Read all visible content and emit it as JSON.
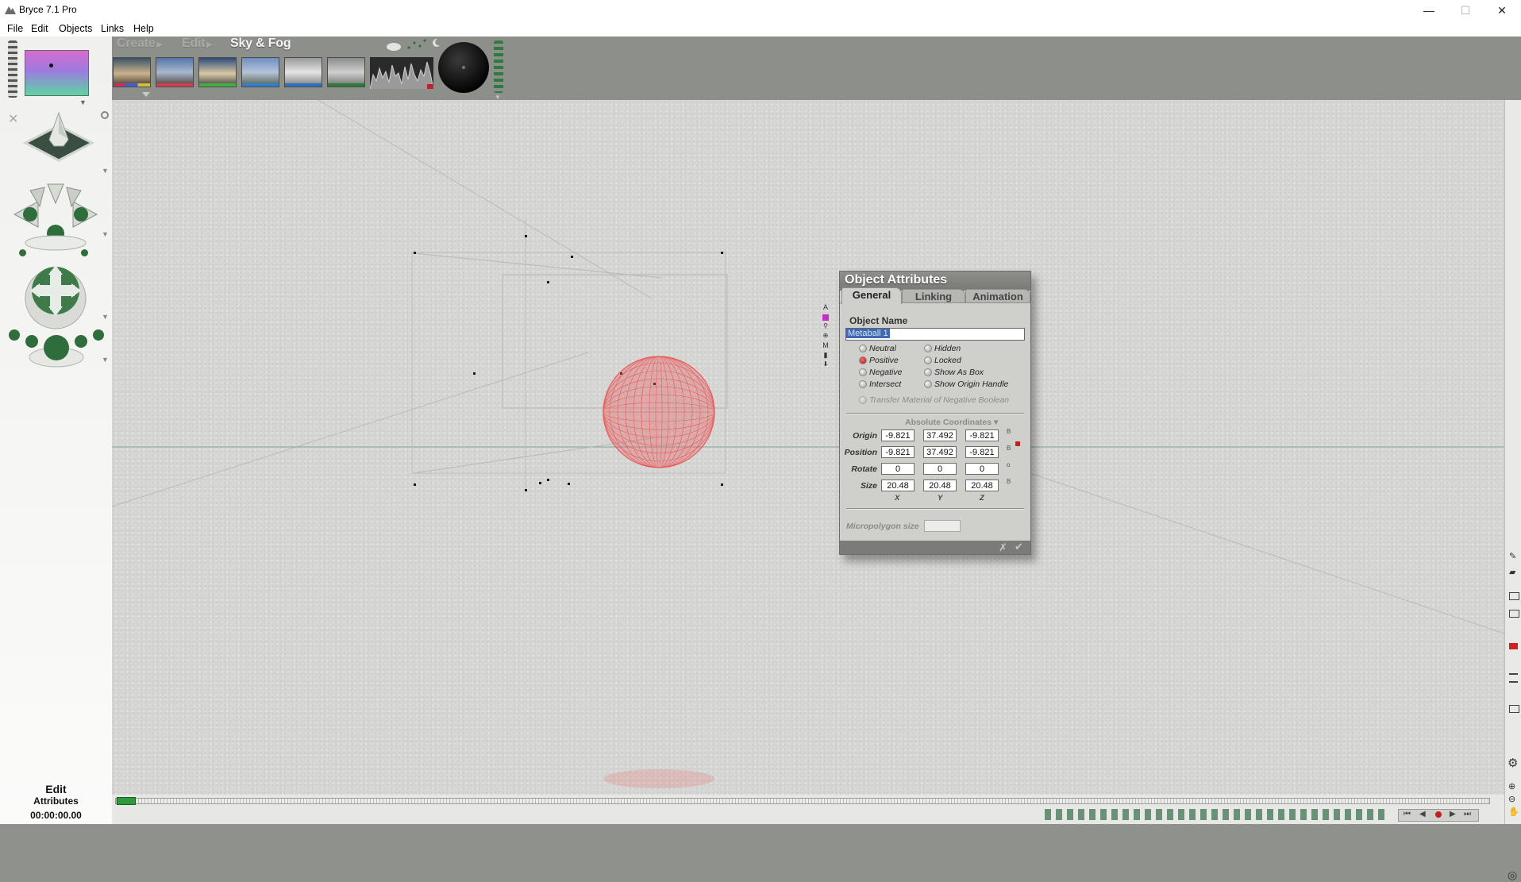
{
  "window": {
    "title": "Bryce 7.1 Pro",
    "minimize_glyph": "—",
    "maximize_glyph": "☐",
    "close_glyph": "✕"
  },
  "menu": [
    "File",
    "Edit",
    "Objects",
    "Links",
    "Help"
  ],
  "palette_tabs": {
    "create": "Create",
    "edit": "Edit",
    "sky_fog": "Sky & Fog"
  },
  "sky_presets": [
    {
      "name": "sky-preset-1",
      "bar_color": "#c03060"
    },
    {
      "name": "sky-preset-2",
      "bar_color": "#d04050"
    },
    {
      "name": "sky-preset-3",
      "bar_color": "#40b040"
    },
    {
      "name": "sky-preset-4",
      "bar_color": "#3080d0"
    },
    {
      "name": "sky-preset-5",
      "bar_color": "#3070c0"
    },
    {
      "name": "sky-preset-6",
      "bar_color": "#2d7d3a"
    }
  ],
  "status": {
    "mode": "Edit",
    "submode": "Attributes",
    "time": "00:00:00.00"
  },
  "dialog": {
    "title": "Object Attributes",
    "tabs": [
      "General",
      "Linking",
      "Animation"
    ],
    "object_name_label": "Object Name",
    "object_name_value": "Metaball 1",
    "boolean_options": [
      {
        "label": "Neutral",
        "selected": false
      },
      {
        "label": "Positive",
        "selected": true
      },
      {
        "label": "Negative",
        "selected": false
      },
      {
        "label": "Intersect",
        "selected": false
      }
    ],
    "flags": [
      {
        "label": "Hidden"
      },
      {
        "label": "Locked"
      },
      {
        "label": "Show As Box"
      },
      {
        "label": "Show Origin Handle"
      }
    ],
    "transfer_material": "Transfer Material of Negative Boolean",
    "coordinates_mode": "Absolute Coordinates",
    "rows": [
      {
        "label": "Origin",
        "x": "-9.821",
        "y": "37.492",
        "z": "-9.821"
      },
      {
        "label": "Position",
        "x": "-9.821",
        "y": "37.492",
        "z": "-9.821"
      },
      {
        "label": "Rotate",
        "x": "0",
        "y": "0",
        "z": "0"
      },
      {
        "label": "Size",
        "x": "20.48",
        "y": "20.48",
        "z": "20.48"
      }
    ],
    "axes": [
      "X",
      "Y",
      "Z"
    ],
    "micropolygon_label": "Micropolygon size",
    "micropolygon_value": "",
    "cancel_glyph": "✗",
    "ok_glyph": "✔"
  },
  "colors": {
    "sphere": "#e85a5a",
    "accent_green": "#2f7a3c",
    "selection": "#3f6ab3"
  }
}
